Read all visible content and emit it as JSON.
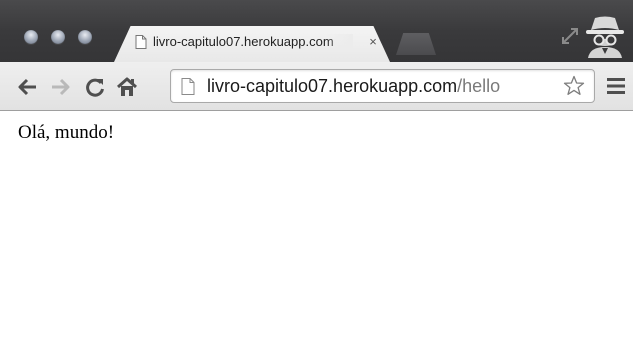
{
  "browser": {
    "tab": {
      "title": "livro-capitulo07.herokuapp.com",
      "close_glyph": "×"
    },
    "address_bar": {
      "url_host": "livro-capitulo07.herokuapp.com",
      "url_path": "/hello"
    },
    "icons": {
      "back": "back-arrow-icon",
      "forward": "forward-arrow-icon",
      "reload": "reload-icon",
      "home": "home-icon",
      "page": "page-icon",
      "bookmark": "star-icon",
      "menu": "hamburger-menu-icon",
      "incognito": "incognito-icon",
      "fullscreen": "resize-arrows-icon"
    },
    "colors": {
      "frame": "#3a3a3c",
      "toolbar": "#e6e6e6",
      "url_path": "#7a7a7a"
    }
  },
  "page": {
    "text": "Olá, mundo!"
  }
}
